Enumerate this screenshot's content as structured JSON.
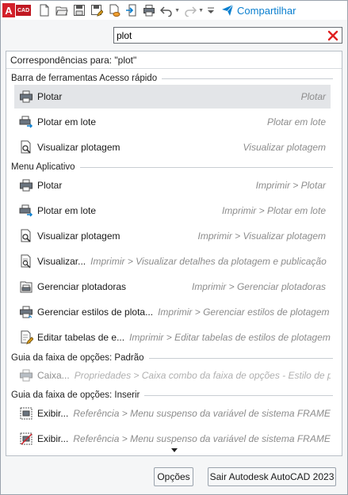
{
  "app": {
    "logo_letter": "A",
    "logo_text": "CAD"
  },
  "toolbar": {
    "buttons": [
      "new-icon",
      "open-icon",
      "save-icon",
      "save-as-icon",
      "cloud-save-icon",
      "import-icon",
      "plot-icon",
      "undo-icon",
      "redo-icon",
      "customize-icon"
    ],
    "share_label": "Compartilhar",
    "accent": "#0a7fcf"
  },
  "search": {
    "value": "plot"
  },
  "results": {
    "header": "Correspondências para: \"plot\"",
    "groups": [
      {
        "title": "Barra de ferramentas Acesso rápido",
        "items": [
          {
            "label": "Plotar",
            "path": "Plotar",
            "icon": "printer-icon",
            "selected": true
          },
          {
            "label": "Plotar em lote",
            "path": "Plotar em lote",
            "icon": "batch-plot-icon"
          },
          {
            "label": "Visualizar plotagem",
            "path": "Visualizar plotagem",
            "icon": "plot-preview-icon"
          }
        ]
      },
      {
        "title": "Menu Aplicativo",
        "items": [
          {
            "label": "Plotar",
            "path": "Imprimir > Plotar",
            "icon": "printer-icon"
          },
          {
            "label": "Plotar em lote",
            "path": "Imprimir > Plotar em lote",
            "icon": "batch-plot-icon"
          },
          {
            "label": "Visualizar plotagem",
            "path": "Imprimir > Visualizar plotagem",
            "icon": "plot-preview-icon"
          },
          {
            "label": "Visualizar...",
            "path": "Imprimir > Visualizar detalhes da plotagem e publicação",
            "icon": "plot-details-icon"
          },
          {
            "label": "Gerenciar plotadoras",
            "path": "Imprimir > Gerenciar plotadoras",
            "icon": "plotter-manager-icon"
          },
          {
            "label": "Gerenciar estilos de plota...",
            "path": "Imprimir > Gerenciar estilos de plotagem",
            "icon": "plot-style-manager-icon"
          },
          {
            "label": "Editar tabelas de e...",
            "path": "Imprimir > Editar tabelas de estilos de plotagem",
            "icon": "edit-plot-style-icon"
          }
        ]
      },
      {
        "title": "Guia da faixa de opções: Padrão",
        "items": [
          {
            "label": "Caixa...",
            "path": "Propriedades > Caixa combo da faixa de opções - Estilo de pl",
            "icon": "combo-box-icon",
            "dim": true
          }
        ]
      },
      {
        "title": "Guia da faixa de opções: Inserir",
        "items": [
          {
            "label": "Exibir...",
            "path": "Referência > Menu suspenso da variável de sistema FRAME l",
            "icon": "frame-display-icon"
          },
          {
            "label": "Exibir...",
            "path": "Referência > Menu suspenso da variável de sistema FRAME l",
            "icon": "frame-hide-icon"
          }
        ]
      }
    ]
  },
  "footer": {
    "options_label": "Opções",
    "exit_label": "Sair Autodesk AutoCAD 2023"
  }
}
